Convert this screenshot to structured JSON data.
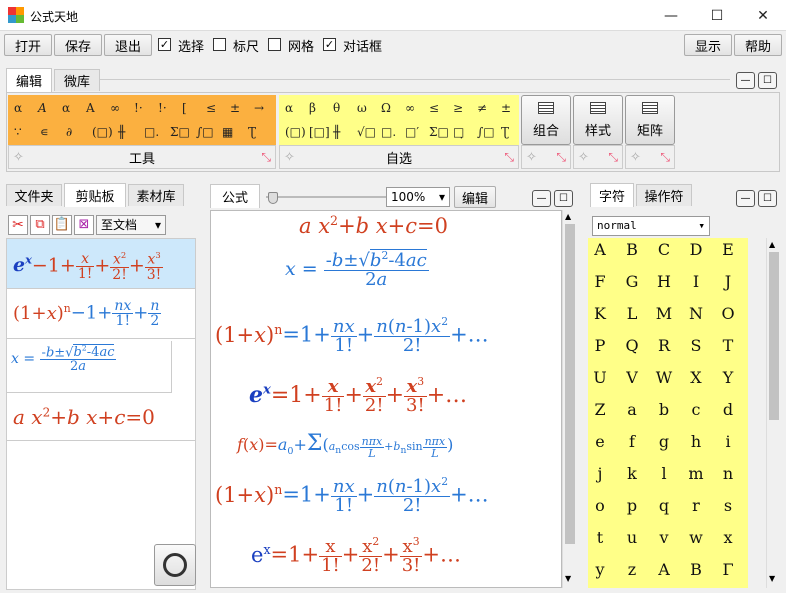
{
  "window": {
    "title": "公式天地",
    "minimize": "—",
    "maximize": "☐",
    "close": "✕"
  },
  "toolbar": {
    "open": "打开",
    "save": "保存",
    "exit": "退出",
    "select": "选择",
    "ruler": "标尺",
    "grid": "网格",
    "dialog": "对话框",
    "show": "显示",
    "help": "帮助",
    "select_checked": "✓",
    "dialog_checked": "✓"
  },
  "top_tabs": {
    "edit": "编辑",
    "micro": "微库"
  },
  "groups": {
    "tools": "工具",
    "custom": "自选"
  },
  "big_buttons": {
    "combine": "组合",
    "style": "样式",
    "matrix": "矩阵"
  },
  "orange_symbols_row1": [
    "α",
    "𝐴",
    "α",
    "A",
    "∞",
    "!·",
    "!·",
    "[",
    "≤",
    "±",
    "→"
  ],
  "orange_symbols_row2": [
    "∵",
    "∊",
    "∂",
    "(□)",
    "╫",
    "□.",
    "Σ□",
    "∫□",
    "▦",
    "Ʈ"
  ],
  "yellow_symbols_row1": [
    "α",
    "β",
    "θ",
    "ω",
    "Ω",
    "∞",
    "≤",
    "≥",
    "≠",
    "±"
  ],
  "yellow_symbols_row2": [
    "(□)",
    "[□]",
    "╫",
    "√□",
    "□.",
    "□′",
    "Σ□",
    "□̣",
    "∫□",
    "Ʈ"
  ],
  "left_panel": {
    "tabs": [
      "文件夹",
      "剪贴板",
      "素材库"
    ],
    "doc_button": "至文档",
    "dropdown": "▾"
  },
  "center_panel": {
    "tab": "公式",
    "zoom": "100%",
    "edit_button": "编辑"
  },
  "right_panel": {
    "tabs": [
      "字符",
      "操作符"
    ],
    "font_select": "normal",
    "letters": [
      "A",
      "B",
      "C",
      "D",
      "E",
      "F",
      "G",
      "H",
      "I",
      "J",
      "K",
      "L",
      "M",
      "N",
      "O",
      "P",
      "Q",
      "R",
      "S",
      "T",
      "U",
      "V",
      "W",
      "X",
      "Y",
      "Z",
      "a",
      "b",
      "c",
      "d",
      "e",
      "f",
      "g",
      "h",
      "i",
      "j",
      "k",
      "l",
      "m",
      "n",
      "o",
      "p",
      "q",
      "r",
      "s",
      "t",
      "u",
      "v",
      "w",
      "x",
      "y",
      "z",
      "A",
      "B",
      "Γ"
    ]
  },
  "formulas": {
    "quad": "ax² + bx + c = 0",
    "root_lhs": "x =",
    "root_num": "-b ± √(b² - 4ac)",
    "root_den": "2a",
    "binom": "(1+x)ⁿ = 1 + nx/1! + n(n-1)x²/2! + ...",
    "exp": "eˣ = 1 + x/1! + x²/2! + x³/3! + ...",
    "fourier": "f(x) = a₀ + Σ (aₙ cos nπx/L + bₙ sin nπx/L)",
    "exp_outline": "eˣ = 1 + x/1! + x²/2! + x³/3! + ..."
  },
  "colors": {
    "orange": "#fbb040",
    "yellow": "#ffff88",
    "formula_orange": "#d04020",
    "formula_blue": "#2a78d6"
  }
}
